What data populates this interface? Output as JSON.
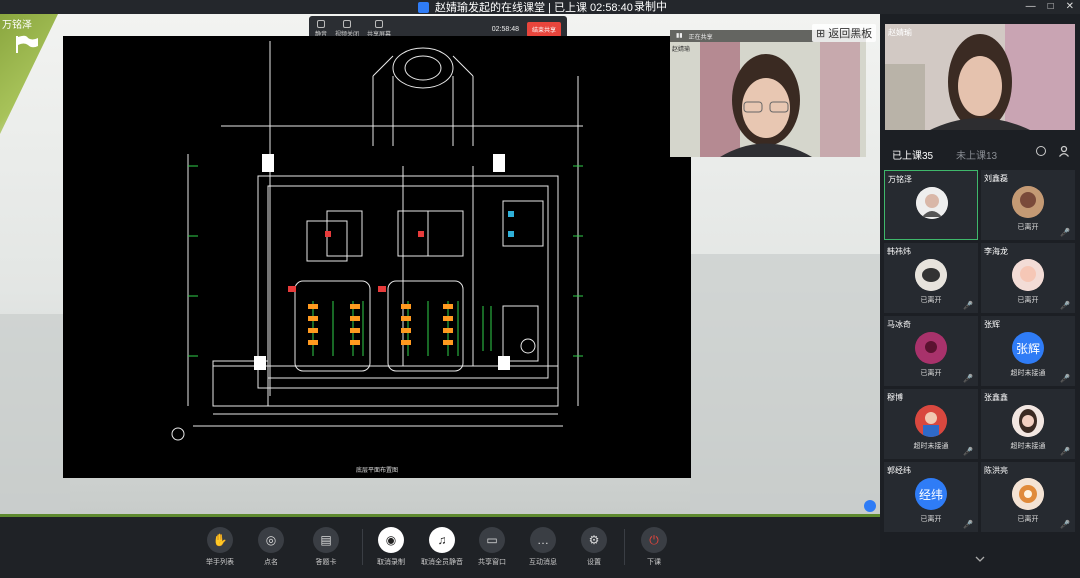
{
  "titlebar": {
    "title": "赵婧瑜发起的在线课堂 | 已上课 02:58:40",
    "record_status": "录制中",
    "window_buttons": [
      "—",
      "□",
      "✕"
    ]
  },
  "stage": {
    "owner_name": "万铭泽",
    "mini_toolbar": {
      "items": [
        "静音",
        "视频关闭",
        "共享屏幕"
      ],
      "timer": "02:58:48",
      "end_label": "结束共享"
    },
    "cad_caption": "底层平面布置图",
    "teacher_video": {
      "label": "赵婧瑜",
      "bar_text": "正在共享"
    },
    "back_board_label": "返回黑板"
  },
  "bottombar": {
    "buttons": [
      {
        "label": "举手列表",
        "icon": "hand-icon"
      },
      {
        "label": "点名",
        "icon": "checkin-icon"
      },
      {
        "label": "答题卡",
        "icon": "answer-card-icon"
      },
      {
        "label": "取消录制",
        "icon": "record-icon"
      },
      {
        "label": "取消全员静音",
        "icon": "mute-all-icon"
      },
      {
        "label": "共享窗口",
        "icon": "share-window-icon"
      },
      {
        "label": "互动消息",
        "icon": "message-icon"
      },
      {
        "label": "设置",
        "icon": "gear-icon"
      },
      {
        "label": "下课",
        "icon": "power-icon"
      }
    ]
  },
  "rightpanel": {
    "host_name": "赵婧瑜",
    "tab_attended": "已上课35",
    "tab_absent": "未上课13",
    "students": [
      {
        "name": "万铭泽",
        "status": "",
        "avatar": "photo",
        "active": true
      },
      {
        "name": "刘鑫磊",
        "status": "已离开",
        "avatar": "photo"
      },
      {
        "name": "韩祎炜",
        "status": "已离开",
        "avatar": "photo"
      },
      {
        "name": "李海龙",
        "status": "已离开",
        "avatar": "photo"
      },
      {
        "name": "马冰奇",
        "status": "已离开",
        "avatar": "photo"
      },
      {
        "name": "张辉",
        "status": "超时未接通",
        "avatar": "张辉"
      },
      {
        "name": "穆博",
        "status": "超时未接通",
        "avatar": "photo"
      },
      {
        "name": "张鑫鑫",
        "status": "超时未接通",
        "avatar": "photo"
      },
      {
        "name": "郭经纬",
        "status": "已离开",
        "avatar": "经纬"
      },
      {
        "name": "陈洪亮",
        "status": "已离开",
        "avatar": "photo"
      }
    ]
  },
  "colors": {
    "accent_green": "#3fb86b",
    "brand_blue": "#2f7cf6",
    "end_red": "#e8453c",
    "bar_green": "#5e8a2f"
  }
}
